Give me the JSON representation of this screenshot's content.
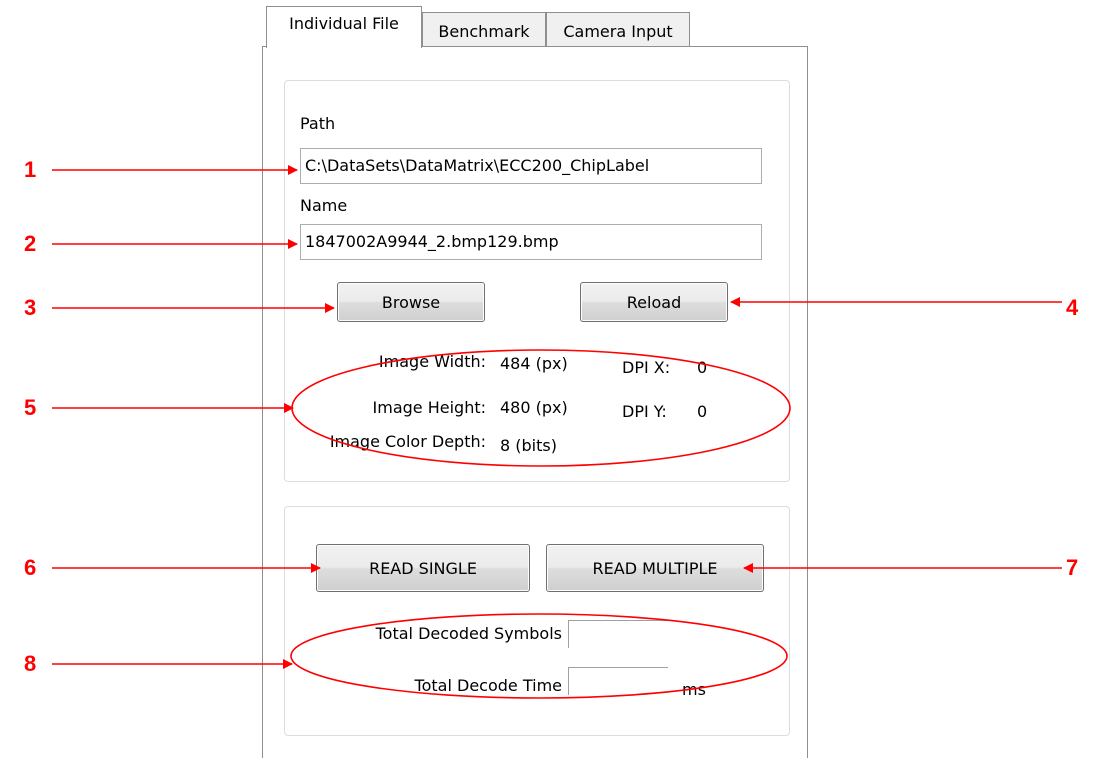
{
  "tabs": [
    {
      "label": "Individual File",
      "active": true
    },
    {
      "label": "Benchmark",
      "active": false
    },
    {
      "label": "Camera Input",
      "active": false
    }
  ],
  "file_group": {
    "path_label": "Path",
    "path_value": "C:\\DataSets\\DataMatrix\\ECC200_ChipLabel",
    "name_label": "Name",
    "name_value": "1847002A9944_2.bmp129.bmp",
    "browse_label": "Browse",
    "reload_label": "Reload",
    "image_width_label": "Image Width:",
    "image_width_value": "484 (px)",
    "image_height_label": "Image Height:",
    "image_height_value": "480 (px)",
    "image_color_depth_label": "Image Color Depth:",
    "image_color_depth_value": "8 (bits)",
    "dpi_x_label": "DPI X:",
    "dpi_x_value": "0",
    "dpi_y_label": "DPI Y:",
    "dpi_y_value": "0"
  },
  "read_group": {
    "read_single_label": "READ SINGLE",
    "read_multiple_label": "READ MULTIPLE",
    "total_decoded_symbols_label": "Total Decoded Symbols",
    "total_decoded_symbols_value": "",
    "total_decode_time_label": "Total Decode Time",
    "total_decode_time_value": "",
    "ms_unit": "ms"
  },
  "callouts": [
    "1",
    "2",
    "3",
    "4",
    "5",
    "6",
    "7",
    "8"
  ],
  "colors": {
    "annotation": "#ff0000",
    "border": "#8e8f8f"
  }
}
